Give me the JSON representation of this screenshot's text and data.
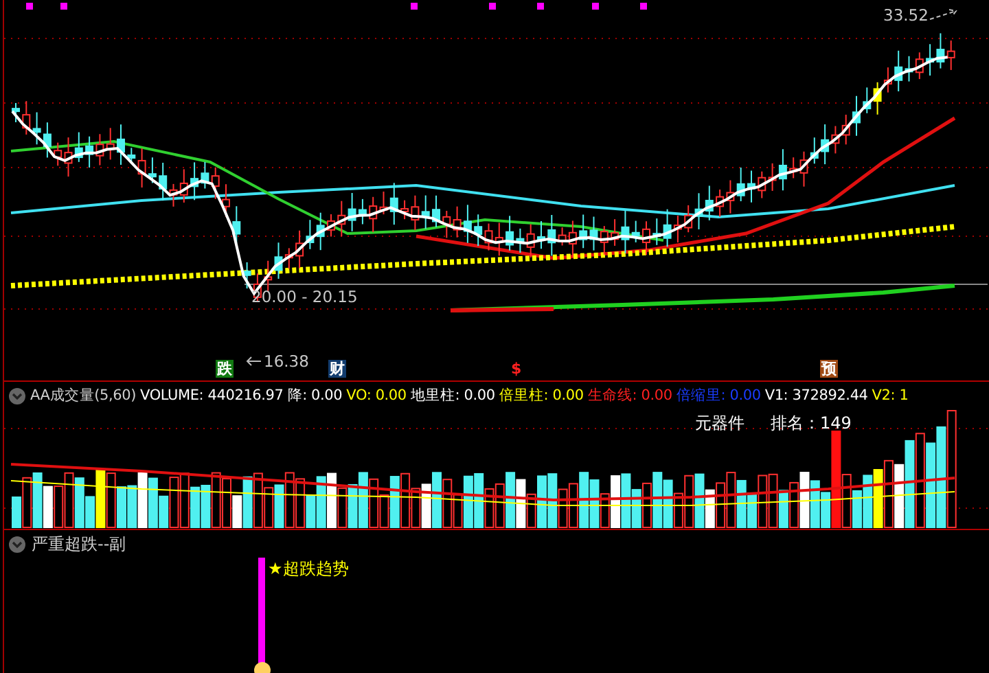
{
  "main_chart": {
    "price_labels": [
      {
        "kind": "high",
        "text": "33.52"
      },
      {
        "kind": "range",
        "text": "20.00 - 20.15"
      },
      {
        "kind": "low",
        "text": "16.38"
      }
    ],
    "event_markers": [
      {
        "kind": "badge",
        "text": "跌",
        "color": "#117a11"
      },
      {
        "kind": "badge",
        "text": "财",
        "color": "#123c6e"
      },
      {
        "kind": "plain",
        "text": "$",
        "color": "#ff2020"
      },
      {
        "kind": "badge",
        "text": "预",
        "color": "#a04a14"
      }
    ]
  },
  "volume_panel": {
    "title": "AA成交量(5,60)",
    "legend": [
      {
        "label": "VOLUME:",
        "value": "440216.97",
        "color": "#ffffff"
      },
      {
        "label": "降:",
        "value": "0.00",
        "color": "#ffffff"
      },
      {
        "label": "VO:",
        "value": "0.00",
        "color": "#ffff00"
      },
      {
        "label": "地里柱:",
        "value": "0.00",
        "color": "#ffffff"
      },
      {
        "label": "倍里柱:",
        "value": "0.00",
        "color": "#ffff00"
      },
      {
        "label": "生命线:",
        "value": "0.00",
        "color": "#ff2020"
      },
      {
        "label": "倍缩里:",
        "value": "0.00",
        "color": "#1a3cff"
      },
      {
        "label": "V1:",
        "value": "372892.44",
        "color": "#ffffff"
      },
      {
        "label": "V2:",
        "value": "1",
        "color": "#ffff00"
      }
    ],
    "sector": "元器件",
    "rank_label": "排名：",
    "rank_value": "149"
  },
  "signal_panel": {
    "title": "严重超跌--副",
    "signal_label": "★超跌趋势"
  }
}
